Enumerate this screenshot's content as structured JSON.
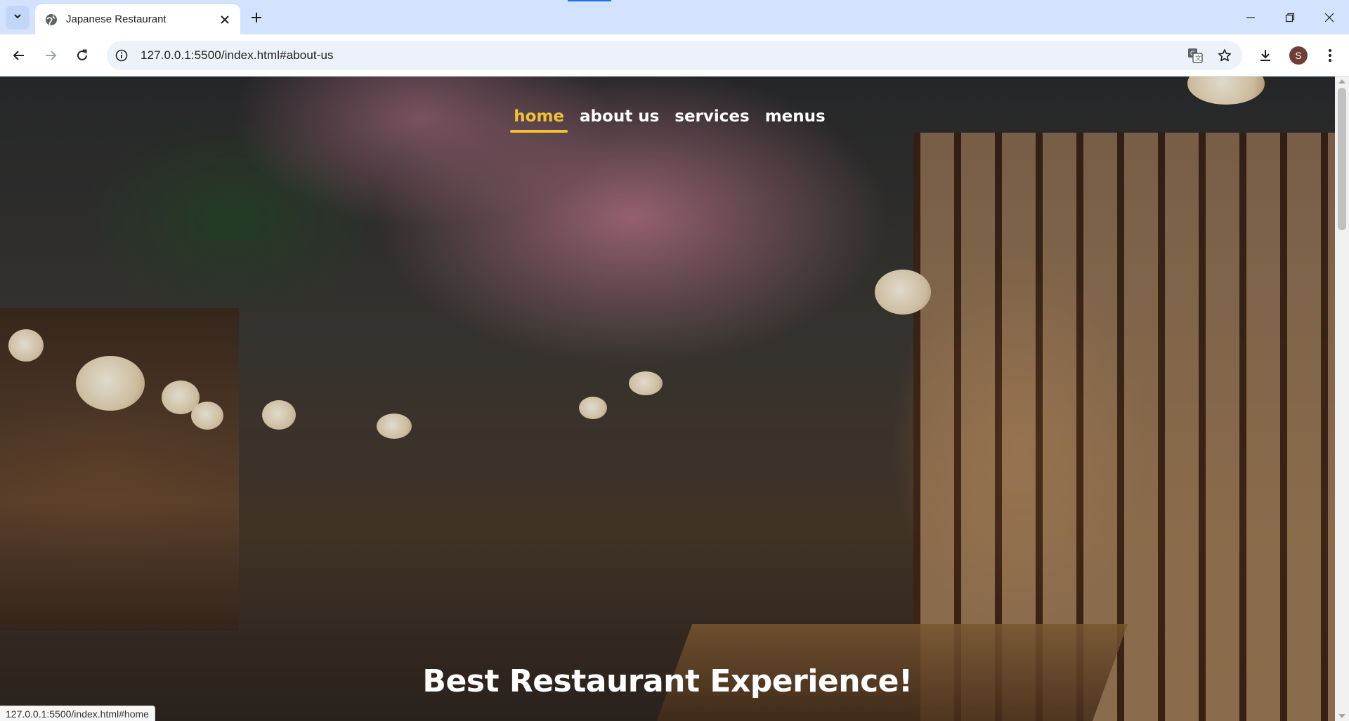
{
  "browser": {
    "tab": {
      "title": "Japanese Restaurant",
      "favicon": "globe-icon"
    },
    "url": "127.0.0.1:5500/index.html#about-us",
    "profile_initial": "S",
    "status_text": "127.0.0.1:5500/index.html#home",
    "accent_color": "#1a73e8"
  },
  "site": {
    "nav": [
      {
        "label": "home",
        "active": true
      },
      {
        "label": "about us",
        "active": false
      },
      {
        "label": "services",
        "active": false
      },
      {
        "label": "menus",
        "active": false
      }
    ],
    "nav_active_color": "#f1c232",
    "hero_heading": "Best Restaurant Experience!"
  }
}
